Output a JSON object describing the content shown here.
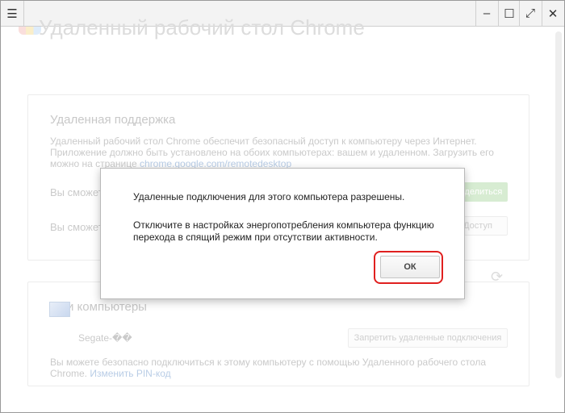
{
  "window": {
    "menu_icon": "☰",
    "minimize": "–",
    "maximize": "☐",
    "restore": "⤢",
    "close": "✕"
  },
  "app": {
    "title": "Удаленный рабочий стол Chrome"
  },
  "remote_support": {
    "title": "Удаленная поддержка",
    "description_1": "Удаленный рабочий стол Chrome обеспечит безопасный доступ к компьютеру через Интернет.",
    "description_2": "Приложение должно быть установлено на обоих компьютерах: вашем и удаленном. Загрузить его",
    "description_3": "можно на странице",
    "link": "chrome.google.com/remotedesktop",
    "row1_text": "Вы сможете",
    "row1_button": "Поделиться",
    "row2_text": "Вы сможете",
    "row2_button": "Доступ"
  },
  "my_computers": {
    "title": "Мои компьютеры",
    "computer_name": "Segate-��",
    "disable_button": "Запретить удаленные подключения",
    "note_1": "Вы можете безопасно подключиться к этому компьютеру с помощью Удаленного рабочего стола",
    "note_2": "Chrome.",
    "change_pin": "Изменить PIN-код"
  },
  "dialog": {
    "line1": "Удаленные подключения для этого компьютера разрешены.",
    "line2": "Отключите в настройках энергопотребления компьютера функцию",
    "line3": "перехода в спящий режим при отсутствии активности.",
    "ok": "ОК"
  },
  "colors": {
    "highlight": "#e0201f"
  }
}
